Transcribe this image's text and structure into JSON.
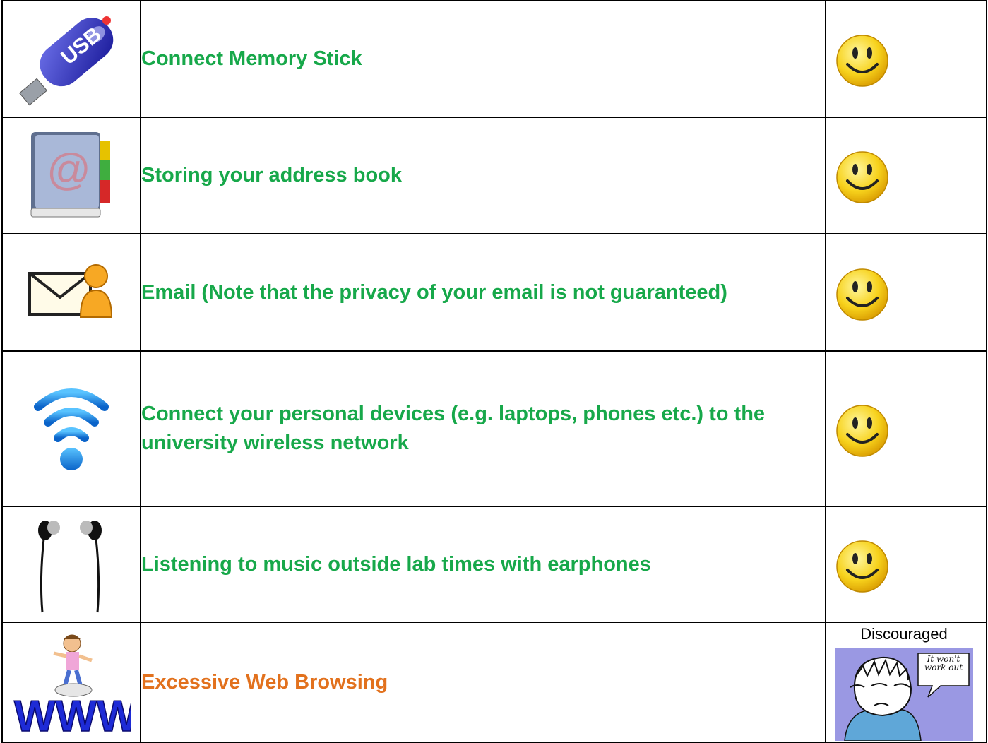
{
  "rows": [
    {
      "text": "Connect Memory Stick",
      "icon": "usb-stick-icon",
      "status": "smiley-icon"
    },
    {
      "text": "Storing your address book",
      "icon": "address-book-icon",
      "status": "smiley-icon"
    },
    {
      "text": "Email (Note that the privacy of your email is not guaranteed)",
      "icon": "email-user-icon",
      "status": "smiley-icon"
    },
    {
      "text": "Connect your personal devices (e.g. laptops, phones etc.) to the university wireless network",
      "icon": "wifi-icon",
      "status": "smiley-icon"
    },
    {
      "text": "Listening to music outside lab times with earphones",
      "icon": "earphones-icon",
      "status": "smiley-icon"
    },
    {
      "text": "Excessive Web Browsing",
      "icon": "www-surfer-icon",
      "status": "discouraged-cartoon"
    }
  ],
  "discouraged": {
    "label": "Discouraged",
    "bubble_text": "It won't work out"
  },
  "icon_texts": {
    "usb": "USB",
    "at": "@",
    "www": "WWW"
  },
  "colors": {
    "allowed_text": "#17a84a",
    "discouraged_text": "#e2711d"
  }
}
